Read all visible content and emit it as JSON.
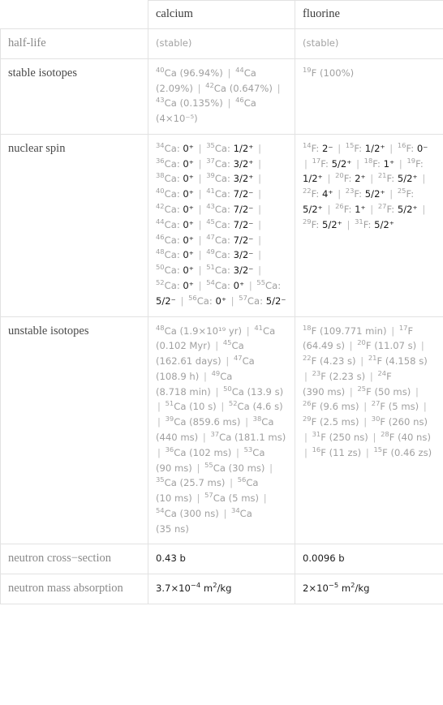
{
  "table": {
    "columns": [
      "",
      "calcium",
      "fluorine"
    ],
    "rows": [
      {
        "label": "half-life",
        "label_muted": true,
        "calcium": {
          "muted": true,
          "text": "(stable)"
        },
        "fluorine": {
          "muted": true,
          "text": "(stable)"
        }
      },
      {
        "label": "stable isotopes",
        "label_muted": false,
        "calcium": {
          "items": [
            {
              "mass": "40",
              "symbol": "Ca",
              "value": "(96.94%)"
            },
            {
              "mass": "44",
              "symbol": "Ca",
              "value": "(2.09%)"
            },
            {
              "mass": "42",
              "symbol": "Ca",
              "value": "(0.647%)"
            },
            {
              "mass": "43",
              "symbol": "Ca",
              "value": "(0.135%)"
            },
            {
              "mass": "46",
              "symbol": "Ca",
              "value": "(4×10⁻⁵)"
            }
          ]
        },
        "fluorine": {
          "items": [
            {
              "mass": "19",
              "symbol": "F",
              "value": "(100%)"
            }
          ]
        }
      },
      {
        "label": "nuclear spin",
        "label_muted": false,
        "calcium": {
          "items": [
            {
              "mass": "34",
              "symbol": "Ca",
              "value": "0⁺"
            },
            {
              "mass": "35",
              "symbol": "Ca",
              "value": "1/2⁺"
            },
            {
              "mass": "36",
              "symbol": "Ca",
              "value": "0⁺"
            },
            {
              "mass": "37",
              "symbol": "Ca",
              "value": "3/2⁺"
            },
            {
              "mass": "38",
              "symbol": "Ca",
              "value": "0⁺"
            },
            {
              "mass": "39",
              "symbol": "Ca",
              "value": "3/2⁺"
            },
            {
              "mass": "40",
              "symbol": "Ca",
              "value": "0⁺"
            },
            {
              "mass": "41",
              "symbol": "Ca",
              "value": "7/2⁻"
            },
            {
              "mass": "42",
              "symbol": "Ca",
              "value": "0⁺"
            },
            {
              "mass": "43",
              "symbol": "Ca",
              "value": "7/2⁻"
            },
            {
              "mass": "44",
              "symbol": "Ca",
              "value": "0⁺"
            },
            {
              "mass": "45",
              "symbol": "Ca",
              "value": "7/2⁻"
            },
            {
              "mass": "46",
              "symbol": "Ca",
              "value": "0⁺"
            },
            {
              "mass": "47",
              "symbol": "Ca",
              "value": "7/2⁻"
            },
            {
              "mass": "48",
              "symbol": "Ca",
              "value": "0⁺"
            },
            {
              "mass": "49",
              "symbol": "Ca",
              "value": "3/2⁻"
            },
            {
              "mass": "50",
              "symbol": "Ca",
              "value": "0⁺"
            },
            {
              "mass": "51",
              "symbol": "Ca",
              "value": "3/2⁻"
            },
            {
              "mass": "52",
              "symbol": "Ca",
              "value": "0⁺"
            },
            {
              "mass": "54",
              "symbol": "Ca",
              "value": "0⁺"
            },
            {
              "mass": "55",
              "symbol": "Ca",
              "value": "5/2⁻"
            },
            {
              "mass": "56",
              "symbol": "Ca",
              "value": "0⁺"
            },
            {
              "mass": "57",
              "symbol": "Ca",
              "value": "5/2⁻"
            }
          ]
        },
        "fluorine": {
          "items": [
            {
              "mass": "14",
              "symbol": "F",
              "value": "2⁻"
            },
            {
              "mass": "15",
              "symbol": "F",
              "value": "1/2⁺"
            },
            {
              "mass": "16",
              "symbol": "F",
              "value": "0⁻"
            },
            {
              "mass": "17",
              "symbol": "F",
              "value": "5/2⁺"
            },
            {
              "mass": "18",
              "symbol": "F",
              "value": "1⁺"
            },
            {
              "mass": "19",
              "symbol": "F",
              "value": "1/2⁺"
            },
            {
              "mass": "20",
              "symbol": "F",
              "value": "2⁺"
            },
            {
              "mass": "21",
              "symbol": "F",
              "value": "5/2⁺"
            },
            {
              "mass": "22",
              "symbol": "F",
              "value": "4⁺"
            },
            {
              "mass": "23",
              "symbol": "F",
              "value": "5/2⁺"
            },
            {
              "mass": "25",
              "symbol": "F",
              "value": "5/2⁺"
            },
            {
              "mass": "26",
              "symbol": "F",
              "value": "1⁺"
            },
            {
              "mass": "27",
              "symbol": "F",
              "value": "5/2⁺"
            },
            {
              "mass": "29",
              "symbol": "F",
              "value": "5/2⁺"
            },
            {
              "mass": "31",
              "symbol": "F",
              "value": "5/2⁺"
            }
          ]
        }
      },
      {
        "label": "unstable isotopes",
        "label_muted": false,
        "calcium": {
          "items": [
            {
              "mass": "48",
              "symbol": "Ca",
              "value": "(1.9×10¹⁹ yr)"
            },
            {
              "mass": "41",
              "symbol": "Ca",
              "value": "(0.102 Myr)"
            },
            {
              "mass": "45",
              "symbol": "Ca",
              "value": "(162.61 days)"
            },
            {
              "mass": "47",
              "symbol": "Ca",
              "value": "(108.9 h)"
            },
            {
              "mass": "49",
              "symbol": "Ca",
              "value": "(8.718 min)"
            },
            {
              "mass": "50",
              "symbol": "Ca",
              "value": "(13.9 s)"
            },
            {
              "mass": "51",
              "symbol": "Ca",
              "value": "(10 s)"
            },
            {
              "mass": "52",
              "symbol": "Ca",
              "value": "(4.6 s)"
            },
            {
              "mass": "39",
              "symbol": "Ca",
              "value": "(859.6 ms)"
            },
            {
              "mass": "38",
              "symbol": "Ca",
              "value": "(440 ms)"
            },
            {
              "mass": "37",
              "symbol": "Ca",
              "value": "(181.1 ms)"
            },
            {
              "mass": "36",
              "symbol": "Ca",
              "value": "(102 ms)"
            },
            {
              "mass": "53",
              "symbol": "Ca",
              "value": "(90 ms)"
            },
            {
              "mass": "55",
              "symbol": "Ca",
              "value": "(30 ms)"
            },
            {
              "mass": "35",
              "symbol": "Ca",
              "value": "(25.7 ms)"
            },
            {
              "mass": "56",
              "symbol": "Ca",
              "value": "(10 ms)"
            },
            {
              "mass": "57",
              "symbol": "Ca",
              "value": "(5 ms)"
            },
            {
              "mass": "54",
              "symbol": "Ca",
              "value": "(300 ns)"
            },
            {
              "mass": "34",
              "symbol": "Ca",
              "value": "(35 ns)"
            }
          ]
        },
        "fluorine": {
          "items": [
            {
              "mass": "18",
              "symbol": "F",
              "value": "(109.771 min)"
            },
            {
              "mass": "17",
              "symbol": "F",
              "value": "(64.49 s)"
            },
            {
              "mass": "20",
              "symbol": "F",
              "value": "(11.07 s)"
            },
            {
              "mass": "22",
              "symbol": "F",
              "value": "(4.23 s)"
            },
            {
              "mass": "21",
              "symbol": "F",
              "value": "(4.158 s)"
            },
            {
              "mass": "23",
              "symbol": "F",
              "value": "(2.23 s)"
            },
            {
              "mass": "24",
              "symbol": "F",
              "value": "(390 ms)"
            },
            {
              "mass": "25",
              "symbol": "F",
              "value": "(50 ms)"
            },
            {
              "mass": "26",
              "symbol": "F",
              "value": "(9.6 ms)"
            },
            {
              "mass": "27",
              "symbol": "F",
              "value": "(5 ms)"
            },
            {
              "mass": "29",
              "symbol": "F",
              "value": "(2.5 ms)"
            },
            {
              "mass": "30",
              "symbol": "F",
              "value": "(260 ns)"
            },
            {
              "mass": "31",
              "symbol": "F",
              "value": "(250 ns)"
            },
            {
              "mass": "28",
              "symbol": "F",
              "value": "(40 ns)"
            },
            {
              "mass": "16",
              "symbol": "F",
              "value": "(11 zs)"
            },
            {
              "mass": "15",
              "symbol": "F",
              "value": "(0.46 zs)"
            }
          ]
        }
      },
      {
        "label": "neutron cross−section",
        "label_muted": true,
        "calcium": {
          "text": "0.43 b"
        },
        "fluorine": {
          "text": "0.0096 b"
        }
      },
      {
        "label": "neutron mass absorption",
        "label_muted": true,
        "calcium": {
          "html": "3.7×10<sup>−4</sup> m<sup>2</sup>/kg"
        },
        "fluorine": {
          "html": "2×10<sup>−5</sup> m<sup>2</sup>/kg"
        }
      }
    ]
  },
  "colors": {
    "border": "#e2e2e2",
    "text": "#3c3c3c",
    "muted": "#a0a0a0",
    "value_dark": "#1a1a1a",
    "separator": "#bdbdbd"
  }
}
